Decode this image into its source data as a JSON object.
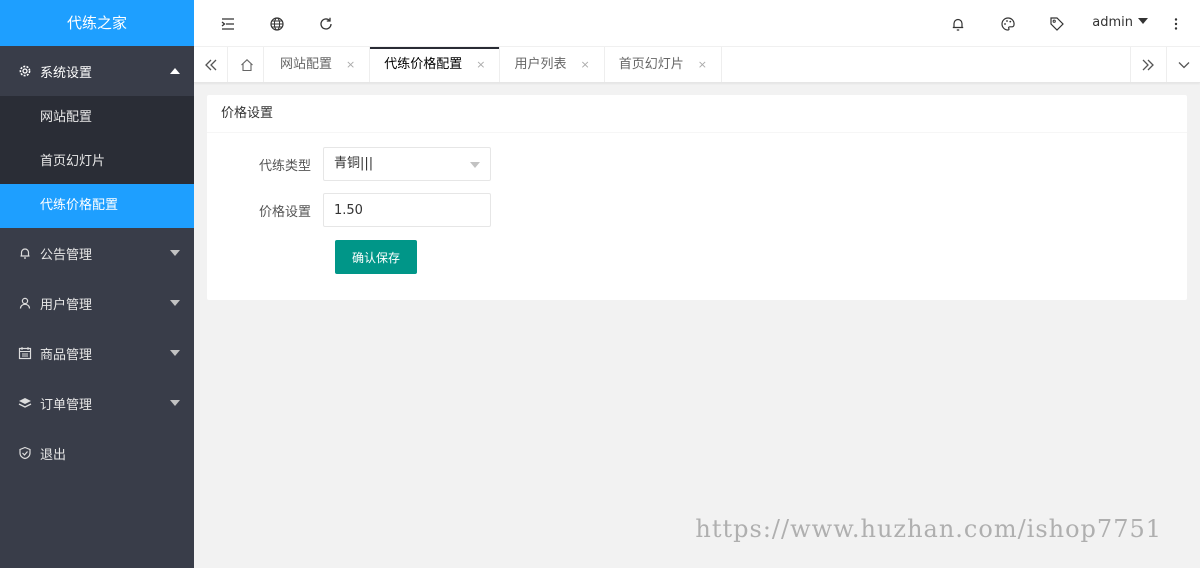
{
  "app": {
    "logo_text": "代练之家"
  },
  "sidebar": {
    "groups": [
      {
        "label": "系统设置",
        "icon": "gear-icon",
        "expanded": true,
        "items": [
          {
            "label": "网站配置",
            "active": false
          },
          {
            "label": "首页幻灯片",
            "active": false
          },
          {
            "label": "代练价格配置",
            "active": true
          }
        ]
      },
      {
        "label": "公告管理",
        "icon": "bell-icon"
      },
      {
        "label": "用户管理",
        "icon": "user-icon"
      },
      {
        "label": "商品管理",
        "icon": "calendar-icon"
      },
      {
        "label": "订单管理",
        "icon": "layers-icon"
      },
      {
        "label": "退出",
        "icon": "shield-check-icon"
      }
    ]
  },
  "header": {
    "left_icons": [
      "menu-fold-icon",
      "globe-icon",
      "refresh-icon"
    ],
    "right_icons": [
      "bell-icon",
      "palette-icon",
      "tag-icon",
      "more-vertical-icon"
    ],
    "user_name": "admin"
  },
  "tabs": {
    "items": [
      {
        "label": "网站配置",
        "active": false
      },
      {
        "label": "代练价格配置",
        "active": true
      },
      {
        "label": "用户列表",
        "active": false
      },
      {
        "label": "首页幻灯片",
        "active": false
      }
    ],
    "close_glyph": "×"
  },
  "card": {
    "title": "价格设置",
    "form": {
      "type_label": "代练类型",
      "type_value": "青铜|||",
      "price_label": "价格设置",
      "price_value": "1.50",
      "save_label": "确认保存"
    }
  },
  "watermark": "https://www.huzhan.com/ishop7751",
  "colors": {
    "sidebar": "#393d49",
    "accent": "#1e9fff",
    "button": "#009688"
  }
}
